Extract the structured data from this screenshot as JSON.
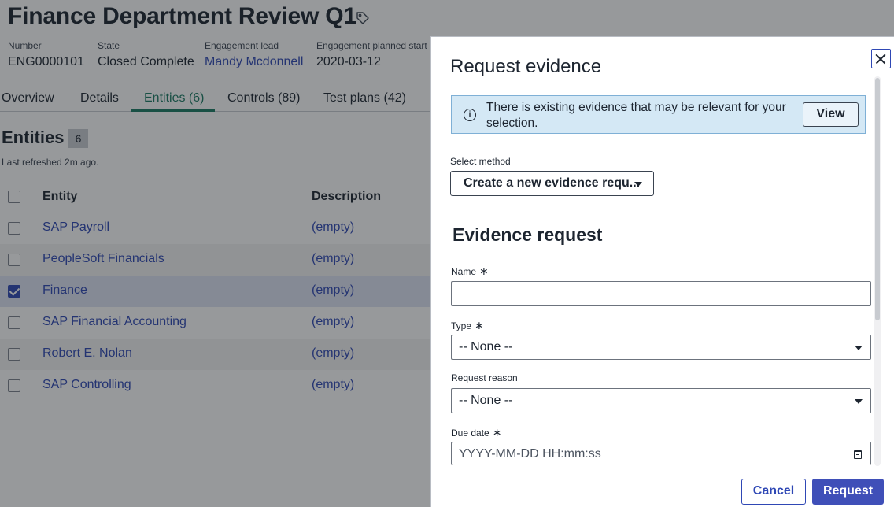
{
  "record": {
    "title": "Finance Department Review Q1",
    "fields": [
      {
        "label": "Number",
        "value": "ENG0000101"
      },
      {
        "label": "State",
        "value": "Closed Complete"
      },
      {
        "label": "Engagement lead",
        "value": "Mandy Mcdonnell"
      },
      {
        "label": "Engagement planned start",
        "value": "2020-03-12"
      }
    ]
  },
  "tabs": [
    {
      "label": "Overview",
      "active": false
    },
    {
      "label": "Details",
      "active": false
    },
    {
      "label": "Entities (6)",
      "active": true
    },
    {
      "label": "Controls (89)",
      "active": false
    },
    {
      "label": "Test plans (42)",
      "active": false
    }
  ],
  "entities": {
    "title": "Entities",
    "count": "6",
    "refreshed": "Last refreshed 2m ago.",
    "columns": [
      "Entity",
      "Description"
    ],
    "rows": [
      {
        "entity": "SAP Payroll",
        "description": "(empty)",
        "checked": false
      },
      {
        "entity": "PeopleSoft Financials",
        "description": "(empty)",
        "checked": false
      },
      {
        "entity": "Finance",
        "description": "(empty)",
        "checked": true
      },
      {
        "entity": "SAP Financial Accounting",
        "description": "(empty)",
        "checked": false
      },
      {
        "entity": "Robert E. Nolan",
        "description": "(empty)",
        "checked": false
      },
      {
        "entity": "SAP Controlling",
        "description": "(empty)",
        "checked": false
      }
    ]
  },
  "modal": {
    "title": "Request evidence",
    "info": {
      "text": "There is existing evidence that may be relevant for your selection.",
      "view_label": "View"
    },
    "method": {
      "label": "Select method",
      "value": "Create a new evidence requ..."
    },
    "section_title": "Evidence request",
    "fields": {
      "name_label": "Name",
      "name_value": "",
      "type_label": "Type",
      "type_value": "-- None --",
      "reason_label": "Request reason",
      "reason_value": "-- None --",
      "due_label": "Due date",
      "due_placeholder": "YYYY-MM-DD HH:mm:ss"
    },
    "required_mark": "∗",
    "cancel_label": "Cancel",
    "request_label": "Request"
  },
  "icons": [
    "tag-icon",
    "info-icon",
    "close-icon",
    "chevron-down-icon",
    "calendar-icon",
    "checkbox-icon"
  ],
  "colors": {
    "link": "#2f48b5",
    "active_tab": "#1b7a63",
    "info_bg": "#d4e8f5",
    "primary_button": "#3f4fb8"
  }
}
